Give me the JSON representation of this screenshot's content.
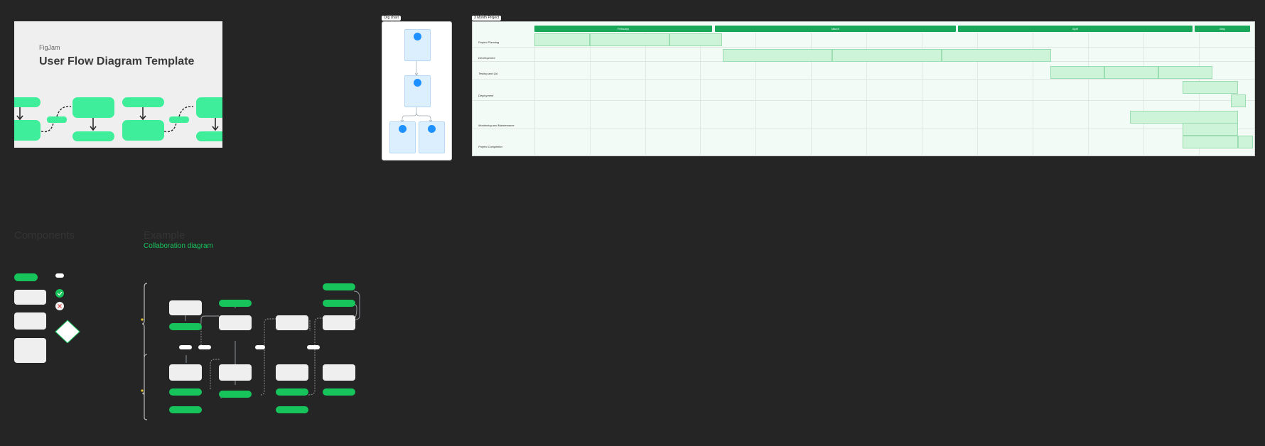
{
  "cover": {
    "brand": "FigJam",
    "title": "User Flow Diagram Template"
  },
  "frames": {
    "org_chart": "Org chart",
    "project": "3 Month Project"
  },
  "gantt": {
    "months": [
      "February",
      "March",
      "April",
      "May"
    ],
    "rows": [
      "Project Planning",
      "Development",
      "Testing and QA",
      "Deployment",
      "Monitoring and Maintenance",
      "Project Completion"
    ]
  },
  "sections": {
    "components": "Components",
    "example": "Example",
    "example_sub": "Collaboration diagram"
  },
  "colors": {
    "canvas": "#252525",
    "mint": "#3eee9a",
    "green": "#17c45c",
    "gantt_header": "#19a85a",
    "org_blue": "#1e90ff"
  }
}
